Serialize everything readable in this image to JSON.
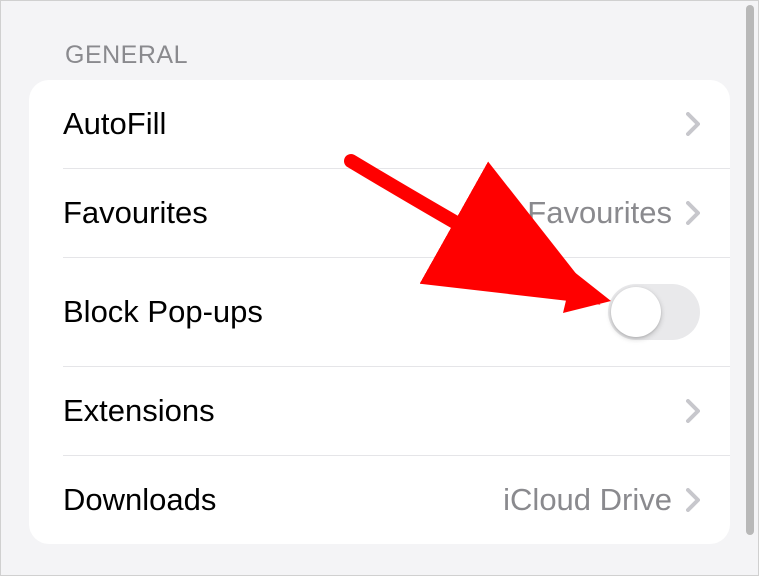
{
  "section": {
    "header": "GENERAL",
    "rows": {
      "autofill": {
        "label": "AutoFill"
      },
      "favourites": {
        "label": "Favourites",
        "value": "Favourites"
      },
      "block_popups": {
        "label": "Block Pop-ups",
        "toggle_on": false
      },
      "extensions": {
        "label": "Extensions"
      },
      "downloads": {
        "label": "Downloads",
        "value": "iCloud Drive"
      }
    }
  },
  "colors": {
    "background": "#f4f4f6",
    "card": "#ffffff",
    "text_primary": "#000000",
    "text_secondary": "#8a8a8e",
    "divider": "#e5e5e8",
    "toggle_off": "#e9e9eb",
    "annotation_red": "#ff0000"
  }
}
